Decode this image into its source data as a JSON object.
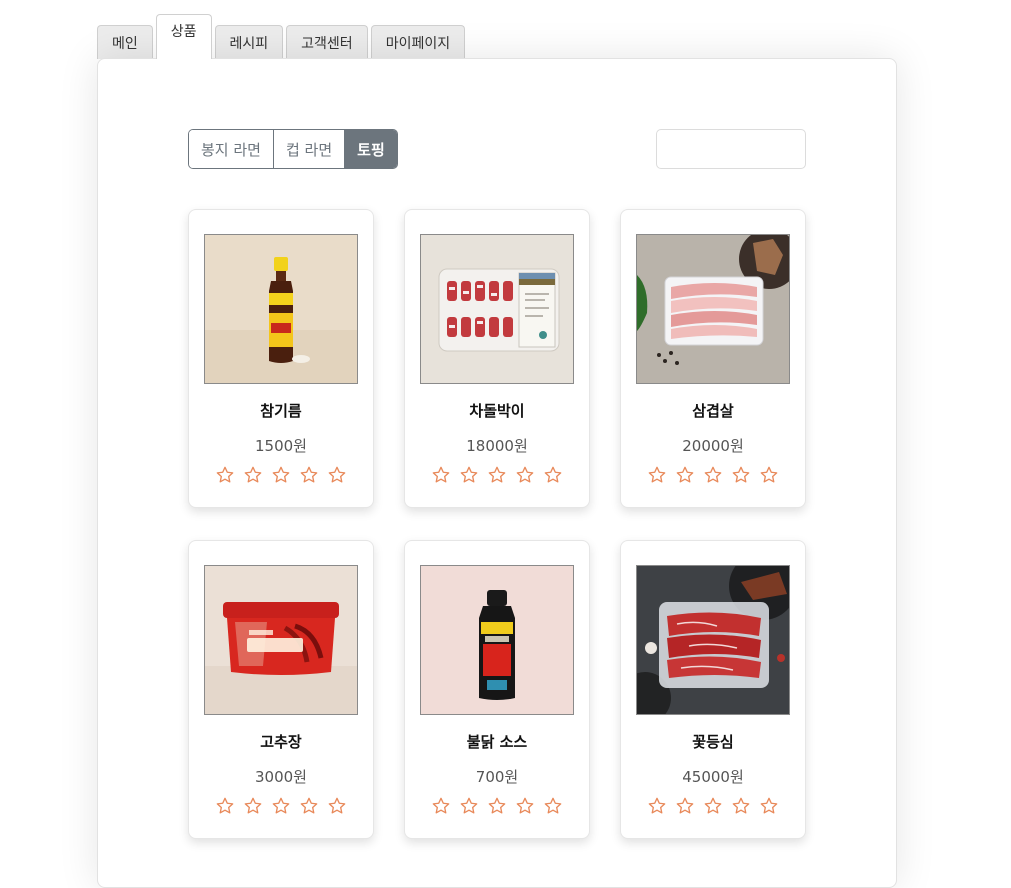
{
  "tabs": [
    {
      "label": "메인",
      "active": false
    },
    {
      "label": "상품",
      "active": true
    },
    {
      "label": "레시피",
      "active": false
    },
    {
      "label": "고객센터",
      "active": false
    },
    {
      "label": "마이페이지",
      "active": false
    }
  ],
  "filters": [
    {
      "label": "봉지 라면",
      "active": false
    },
    {
      "label": "컵 라면",
      "active": false
    },
    {
      "label": "토핑",
      "active": true
    }
  ],
  "search": {
    "value": "",
    "placeholder": ""
  },
  "products": [
    {
      "name": "참기름",
      "price": "1500원",
      "rating": 0,
      "image": "sesame-oil-bottle"
    },
    {
      "name": "차돌박이",
      "price": "18000원",
      "rating": 0,
      "image": "brisket-rolls-pack"
    },
    {
      "name": "삼겹살",
      "price": "20000원",
      "rating": 0,
      "image": "pork-belly-tray"
    },
    {
      "name": "고추장",
      "price": "3000원",
      "rating": 0,
      "image": "gochujang-tub"
    },
    {
      "name": "불닭 소스",
      "price": "700원",
      "rating": 0,
      "image": "buldak-sauce-bottle"
    },
    {
      "name": "꽃등심",
      "price": "45000원",
      "rating": 0,
      "image": "ribeye-beef-tray"
    }
  ],
  "colors": {
    "star": "#e8895a",
    "filter_active": "#6c757d"
  }
}
